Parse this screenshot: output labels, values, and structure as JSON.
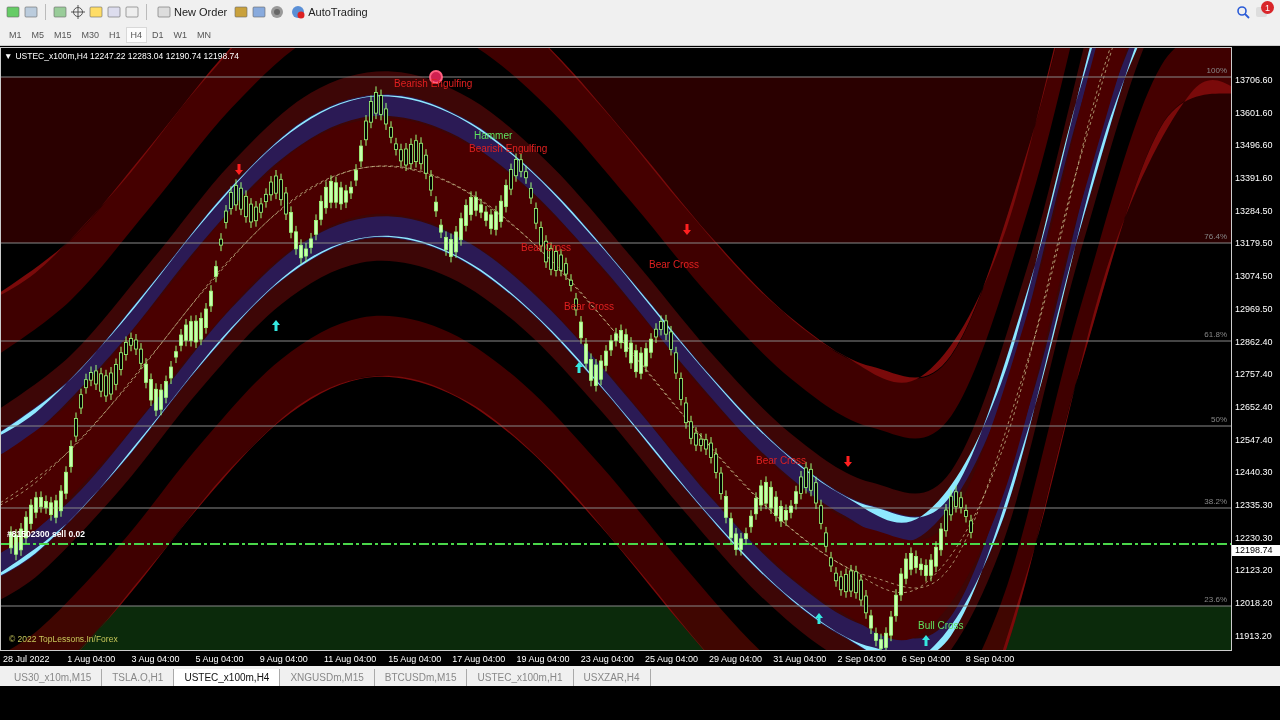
{
  "toolbar": {
    "new_order": "New Order",
    "auto_trading": "AutoTrading",
    "notification_count": "1"
  },
  "timeframes": [
    {
      "label": "M1",
      "selected": false
    },
    {
      "label": "M5",
      "selected": false
    },
    {
      "label": "M15",
      "selected": false
    },
    {
      "label": "M30",
      "selected": false
    },
    {
      "label": "H1",
      "selected": false
    },
    {
      "label": "H4",
      "selected": true
    },
    {
      "label": "D1",
      "selected": false
    },
    {
      "label": "W1",
      "selected": false
    },
    {
      "label": "MN",
      "selected": false
    }
  ],
  "chart": {
    "collapse_glyph": "▼",
    "header": "USTEC_x100m,H4  12247.22 12283.04 12190.74 12198.74",
    "fib_levels": [
      "100%",
      "76.4%",
      "61.8%",
      "50%",
      "38.2%",
      "23.6%"
    ],
    "patterns": [
      {
        "label": "Bearish Engulfing",
        "kind": "bearish"
      },
      {
        "label": "Hammer",
        "kind": "bullish"
      },
      {
        "label": "Bearish Engulfing",
        "kind": "bearish"
      },
      {
        "label": "Bear Cross",
        "kind": "bearish"
      },
      {
        "label": "Bear Cross",
        "kind": "bearish"
      },
      {
        "label": "Bear Cross",
        "kind": "bearish"
      },
      {
        "label": "Bear Cross",
        "kind": "bearish"
      },
      {
        "label": "Bull Cross",
        "kind": "bullish"
      }
    ],
    "order_label": "#81502300 sell 0.02",
    "copyright": "© 2022 TopLessons.In/Forex",
    "price_axis": [
      "13706.60",
      "13601.60",
      "13496.60",
      "13391.60",
      "13284.50",
      "13179.50",
      "13074.50",
      "12969.50",
      "12862.40",
      "12757.40",
      "12652.40",
      "12547.40",
      "12440.30",
      "12335.30",
      "12230.30",
      "12123.20",
      "12018.20",
      "11913.20"
    ],
    "current_price": "12198.74",
    "time_axis": [
      "28 Jul 2022",
      "1 Aug 04:00",
      "3 Aug 04:00",
      "5 Aug 04:00",
      "9 Aug 04:00",
      "11 Aug 04:00",
      "15 Aug 04:00",
      "17 Aug 04:00",
      "19 Aug 04:00",
      "23 Aug 04:00",
      "25 Aug 04:00",
      "29 Aug 04:00",
      "31 Aug 04:00",
      "2 Sep 04:00",
      "6 Sep 04:00",
      "8 Sep 04:00"
    ]
  },
  "chart_tabs": [
    {
      "label": "US30_x10m,M15",
      "selected": false
    },
    {
      "label": "TSLA.O,H1",
      "selected": false
    },
    {
      "label": "USTEC_x100m,H4",
      "selected": true
    },
    {
      "label": "XNGUSDm,M15",
      "selected": false
    },
    {
      "label": "BTCUSDm,M15",
      "selected": false
    },
    {
      "label": "USTEC_x100m,H1",
      "selected": false
    },
    {
      "label": "USXZAR,H4",
      "selected": false
    }
  ]
}
